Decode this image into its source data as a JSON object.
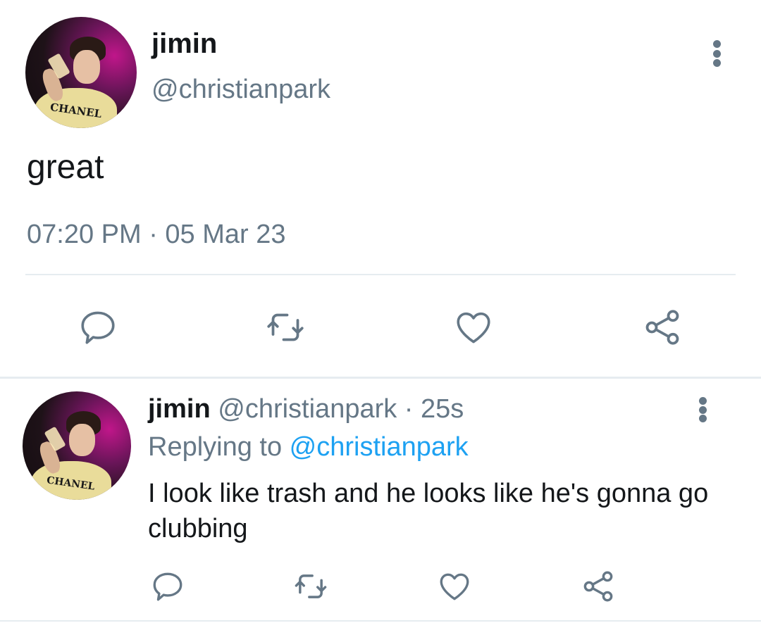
{
  "main_tweet": {
    "display_name": "jimin",
    "handle": "@christianpark",
    "avatar_logo_text": "CHANEL",
    "text": "great",
    "timestamp": "07:20 PM · 05 Mar 23"
  },
  "reply_tweet": {
    "display_name": "jimin",
    "handle": "@christianpark",
    "separator": " · ",
    "age": "25s",
    "replying_prefix": "Replying to ",
    "replying_mention": "@christianpark",
    "avatar_logo_text": "CHANEL",
    "text": "I look like trash and he looks like he's gonna go clubbing"
  },
  "icons": {
    "more": "more-vertical-icon",
    "reply": "comment-bubble-icon",
    "retweet": "retweet-icon",
    "like": "heart-icon",
    "share": "share-icon"
  },
  "colors": {
    "text_primary": "#14171a",
    "text_secondary": "#657786",
    "link": "#1da1f2",
    "divider": "#e6ecf0"
  }
}
